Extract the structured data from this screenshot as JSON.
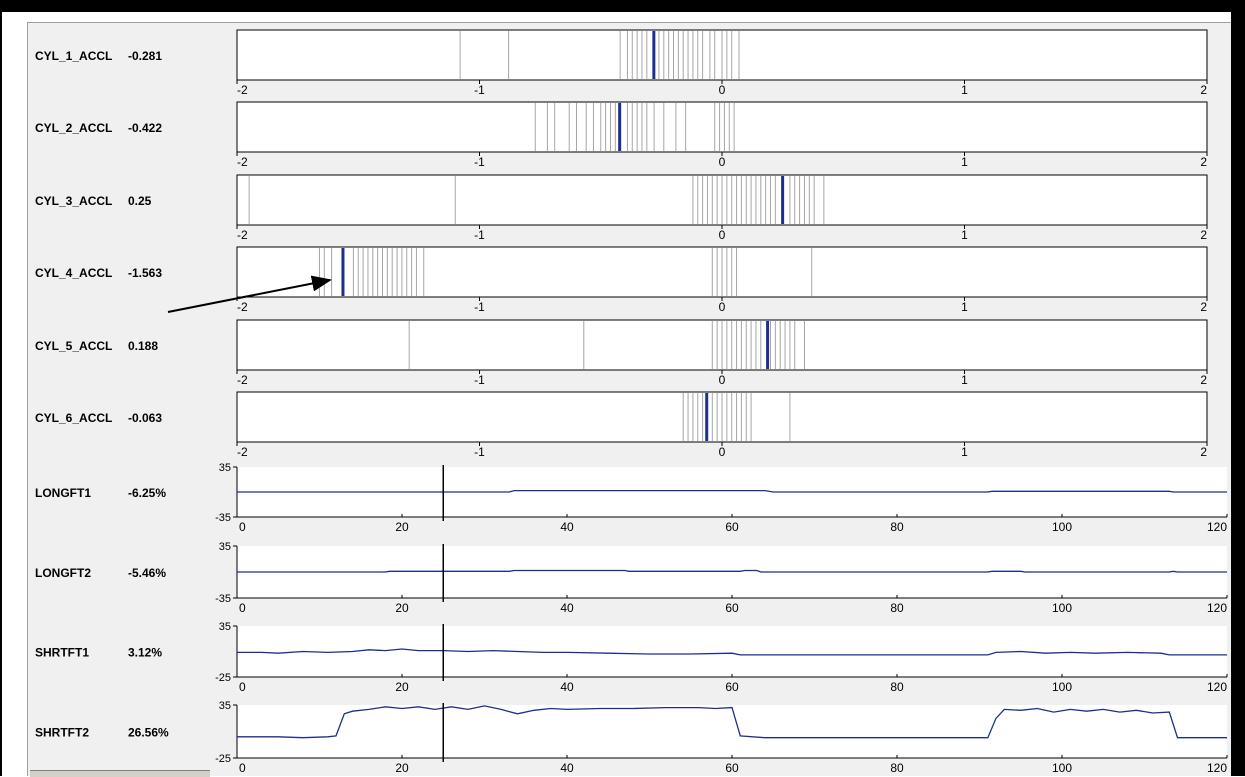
{
  "chart_data": [
    {
      "type": "strip",
      "name": "CYL_1_ACCL",
      "value": "-0.281",
      "xlim": [
        -2,
        2
      ],
      "x_ticks": [
        "-2",
        "-1",
        "0",
        "1",
        "2"
      ],
      "current": -0.281,
      "ticks": [
        -1.08,
        -0.88,
        -0.42,
        -0.39,
        -0.37,
        -0.35,
        -0.33,
        -0.31,
        -0.26,
        -0.24,
        -0.22,
        -0.2,
        -0.18,
        -0.16,
        -0.14,
        -0.12,
        -0.1,
        -0.08,
        -0.05,
        -0.03,
        0.0,
        0.02,
        0.04,
        0.07
      ]
    },
    {
      "type": "strip",
      "name": "CYL_2_ACCL",
      "value": "-0.422",
      "xlim": [
        -2,
        2
      ],
      "x_ticks": [
        "-2",
        "-1",
        "0",
        "1",
        "2"
      ],
      "current": -0.422,
      "ticks": [
        -0.77,
        -0.72,
        -0.69,
        -0.63,
        -0.6,
        -0.56,
        -0.53,
        -0.5,
        -0.48,
        -0.46,
        -0.44,
        -0.39,
        -0.37,
        -0.35,
        -0.33,
        -0.31,
        -0.28,
        -0.24,
        -0.19,
        -0.15,
        -0.03,
        -0.01,
        0.01,
        0.03,
        0.05
      ]
    },
    {
      "type": "strip",
      "name": "CYL_3_ACCL",
      "value": "0.25",
      "xlim": [
        -2,
        2
      ],
      "x_ticks": [
        "-2",
        "-1",
        "0",
        "1",
        "2"
      ],
      "current": 0.25,
      "ticks": [
        -1.95,
        -1.1,
        -0.12,
        -0.1,
        -0.08,
        -0.06,
        -0.04,
        -0.02,
        0.0,
        0.02,
        0.04,
        0.06,
        0.08,
        0.1,
        0.12,
        0.14,
        0.16,
        0.18,
        0.2,
        0.22,
        0.28,
        0.3,
        0.32,
        0.34,
        0.36,
        0.38,
        0.42
      ]
    },
    {
      "type": "strip",
      "name": "CYL_4_ACCL",
      "value": "-1.563",
      "xlim": [
        -2,
        2
      ],
      "x_ticks": [
        "-2",
        "-1",
        "0",
        "1",
        "2"
      ],
      "current": -1.563,
      "ticks": [
        -1.66,
        -1.64,
        -1.61,
        -1.52,
        -1.5,
        -1.48,
        -1.46,
        -1.44,
        -1.42,
        -1.4,
        -1.38,
        -1.36,
        -1.34,
        -1.32,
        -1.3,
        -1.28,
        -1.26,
        -1.23,
        -0.04,
        -0.02,
        0.0,
        0.02,
        0.04,
        0.06,
        0.37
      ]
    },
    {
      "type": "strip",
      "name": "CYL_5_ACCL",
      "value": "0.188",
      "xlim": [
        -2,
        2
      ],
      "x_ticks": [
        "-2",
        "-1",
        "0",
        "1",
        "2"
      ],
      "current": 0.188,
      "ticks": [
        -1.29,
        -0.57,
        -0.04,
        -0.02,
        0.0,
        0.02,
        0.04,
        0.06,
        0.08,
        0.1,
        0.12,
        0.14,
        0.16,
        0.2,
        0.22,
        0.24,
        0.26,
        0.28,
        0.3,
        0.34
      ]
    },
    {
      "type": "strip",
      "name": "CYL_6_ACCL",
      "value": "-0.063",
      "xlim": [
        -2,
        2
      ],
      "x_ticks": [
        "-2",
        "-1",
        "0",
        "1",
        "2"
      ],
      "current": -0.063,
      "ticks": [
        -0.16,
        -0.14,
        -0.12,
        -0.1,
        -0.08,
        -0.04,
        -0.02,
        0.0,
        0.02,
        0.04,
        0.06,
        0.08,
        0.1,
        0.12,
        0.28
      ]
    },
    {
      "type": "line",
      "name": "LONGFT1",
      "value": "-6.25%",
      "xlim": [
        0,
        120
      ],
      "ylim": [
        -35,
        35
      ],
      "x_ticks": [
        "0",
        "20",
        "40",
        "60",
        "80",
        "100",
        "120"
      ],
      "y_ticks": [
        "35",
        "-35"
      ],
      "cursor_x": 25,
      "points": [
        [
          0,
          0
        ],
        [
          33,
          0
        ],
        [
          33.6,
          2
        ],
        [
          64,
          2
        ],
        [
          65,
          0
        ],
        [
          91,
          0
        ],
        [
          91.5,
          1
        ],
        [
          113,
          1
        ],
        [
          113.5,
          0
        ],
        [
          120,
          0
        ]
      ]
    },
    {
      "type": "line",
      "name": "LONGFT2",
      "value": "-5.46%",
      "xlim": [
        0,
        120
      ],
      "ylim": [
        -35,
        35
      ],
      "x_ticks": [
        "0",
        "20",
        "40",
        "60",
        "80",
        "100",
        "120"
      ],
      "y_ticks": [
        "35",
        "-35"
      ],
      "cursor_x": 25,
      "points": [
        [
          0,
          0
        ],
        [
          18,
          0
        ],
        [
          18.5,
          1
        ],
        [
          33,
          1
        ],
        [
          33.6,
          2
        ],
        [
          47,
          2
        ],
        [
          47.5,
          1
        ],
        [
          61,
          1
        ],
        [
          61.5,
          2
        ],
        [
          63,
          2
        ],
        [
          63.5,
          0
        ],
        [
          91,
          0
        ],
        [
          91.5,
          1
        ],
        [
          95,
          1
        ],
        [
          95.5,
          0
        ],
        [
          113,
          0
        ],
        [
          113.5,
          1
        ],
        [
          114,
          0
        ],
        [
          120,
          0
        ]
      ]
    },
    {
      "type": "line",
      "name": "SHRTFT1",
      "value": "3.12%",
      "xlim": [
        0,
        120
      ],
      "ylim": [
        -25,
        35
      ],
      "x_ticks": [
        "0",
        "20",
        "40",
        "60",
        "80",
        "100",
        "120"
      ],
      "y_ticks": [
        "35",
        "-25"
      ],
      "cursor_x": 25,
      "points": [
        [
          0,
          4
        ],
        [
          3,
          4
        ],
        [
          5,
          3
        ],
        [
          8,
          5
        ],
        [
          11,
          4
        ],
        [
          14,
          5
        ],
        [
          16,
          7
        ],
        [
          18,
          6
        ],
        [
          20,
          8
        ],
        [
          22,
          6
        ],
        [
          25,
          6
        ],
        [
          28,
          5
        ],
        [
          31,
          6
        ],
        [
          34,
          5
        ],
        [
          37,
          4
        ],
        [
          40,
          4
        ],
        [
          45,
          3
        ],
        [
          50,
          2
        ],
        [
          55,
          2
        ],
        [
          60,
          3
        ],
        [
          61,
          1
        ],
        [
          70,
          1
        ],
        [
          80,
          1
        ],
        [
          91,
          1
        ],
        [
          92,
          4
        ],
        [
          95,
          5
        ],
        [
          98,
          3
        ],
        [
          101,
          4
        ],
        [
          104,
          3
        ],
        [
          108,
          4
        ],
        [
          112,
          3
        ],
        [
          113,
          1
        ],
        [
          120,
          1
        ]
      ]
    },
    {
      "type": "line",
      "name": "SHRTFT2",
      "value": "26.56%",
      "xlim": [
        0,
        120
      ],
      "ylim": [
        -25,
        35
      ],
      "x_ticks": [
        "0",
        "20",
        "40",
        "60",
        "80",
        "100",
        "120"
      ],
      "y_ticks": [
        "35",
        "-25"
      ],
      "cursor_x": 25,
      "points": [
        [
          0,
          -1
        ],
        [
          5,
          -1
        ],
        [
          8,
          -2
        ],
        [
          11,
          -1
        ],
        [
          12,
          0
        ],
        [
          13,
          25
        ],
        [
          14,
          28
        ],
        [
          16,
          30
        ],
        [
          18,
          33
        ],
        [
          20,
          31
        ],
        [
          22,
          33
        ],
        [
          24,
          30
        ],
        [
          26,
          33
        ],
        [
          28,
          30
        ],
        [
          30,
          34
        ],
        [
          32,
          30
        ],
        [
          34,
          25
        ],
        [
          36,
          29
        ],
        [
          38,
          31
        ],
        [
          40,
          30
        ],
        [
          44,
          31
        ],
        [
          48,
          31
        ],
        [
          52,
          32
        ],
        [
          56,
          32
        ],
        [
          58,
          31
        ],
        [
          60,
          32
        ],
        [
          61,
          0
        ],
        [
          64,
          -2
        ],
        [
          80,
          -2
        ],
        [
          91,
          -2
        ],
        [
          92,
          20
        ],
        [
          93,
          30
        ],
        [
          95,
          29
        ],
        [
          97,
          31
        ],
        [
          99,
          27
        ],
        [
          101,
          30
        ],
        [
          103,
          28
        ],
        [
          105,
          30
        ],
        [
          107,
          27
        ],
        [
          109,
          29
        ],
        [
          111,
          26
        ],
        [
          113,
          27
        ],
        [
          114,
          -2
        ],
        [
          120,
          -2
        ]
      ]
    }
  ]
}
